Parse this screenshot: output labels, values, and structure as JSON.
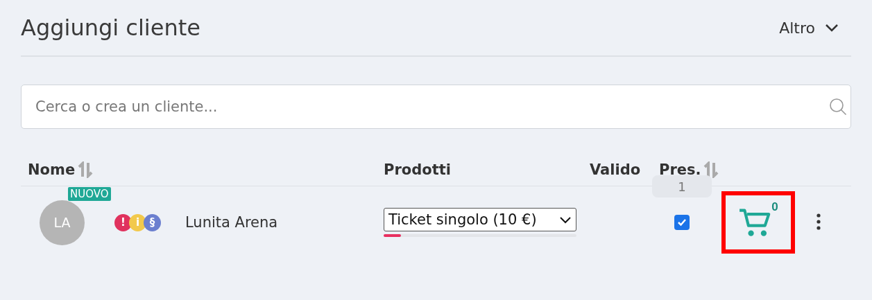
{
  "header": {
    "title": "Aggiungi cliente",
    "menu_label": "Altro"
  },
  "search": {
    "placeholder": "Cerca o crea un cliente..."
  },
  "table": {
    "columns": [
      {
        "label": "Nome",
        "sortable": true
      },
      {
        "label": "Prodotti",
        "sortable": false
      },
      {
        "label": "Valido",
        "sortable": false
      },
      {
        "label": "Pres.",
        "sortable": true
      }
    ],
    "rows": [
      {
        "initials": "LA",
        "badge": "NUOVO",
        "flags": [
          {
            "symbol": "!",
            "color": "#e0325e"
          },
          {
            "symbol": "i",
            "color": "#f2c94c"
          },
          {
            "symbol": "§",
            "color": "#6b7fcf"
          }
        ],
        "name": "Lunita Arena",
        "product": "Ticket singolo (10 €)",
        "level": 0.09,
        "presence_count": "1",
        "present": true,
        "cart_count": "0",
        "highlighted": true
      }
    ]
  }
}
